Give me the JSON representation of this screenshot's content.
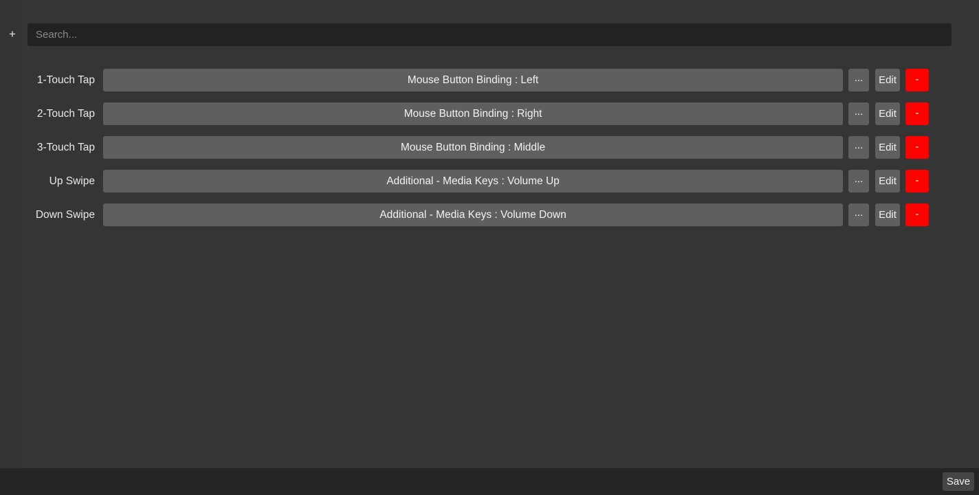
{
  "colors": {
    "window_background": "#333333",
    "panel_background": "#353535",
    "search_background": "#222222",
    "binding_bar": "#5f5f5f",
    "button_gray": "#5f5f5f",
    "button_red": "#fe0000",
    "bottom_bar": "#252525",
    "save_button": "#454545",
    "text_primary": "#f2f2f2",
    "text_placeholder": "#8a8a8a"
  },
  "toolbar": {
    "add_label": "+",
    "add_icon": "plus-icon"
  },
  "search": {
    "value": "",
    "placeholder": "Search..."
  },
  "rows": [
    {
      "label": "1-Touch Tap",
      "binding": "Mouse Button Binding : Left",
      "dots_label": "...",
      "edit_label": "Edit",
      "remove_label": "-"
    },
    {
      "label": "2-Touch Tap",
      "binding": "Mouse Button Binding : Right",
      "dots_label": "...",
      "edit_label": "Edit",
      "remove_label": "-"
    },
    {
      "label": "3-Touch Tap",
      "binding": "Mouse Button Binding : Middle",
      "dots_label": "...",
      "edit_label": "Edit",
      "remove_label": "-"
    },
    {
      "label": "Up Swipe",
      "binding": "Additional - Media Keys : Volume Up",
      "dots_label": "...",
      "edit_label": "Edit",
      "remove_label": "-"
    },
    {
      "label": "Down Swipe",
      "binding": "Additional - Media Keys : Volume Down",
      "dots_label": "...",
      "edit_label": "Edit",
      "remove_label": "-"
    }
  ],
  "footer": {
    "save_label": "Save"
  }
}
